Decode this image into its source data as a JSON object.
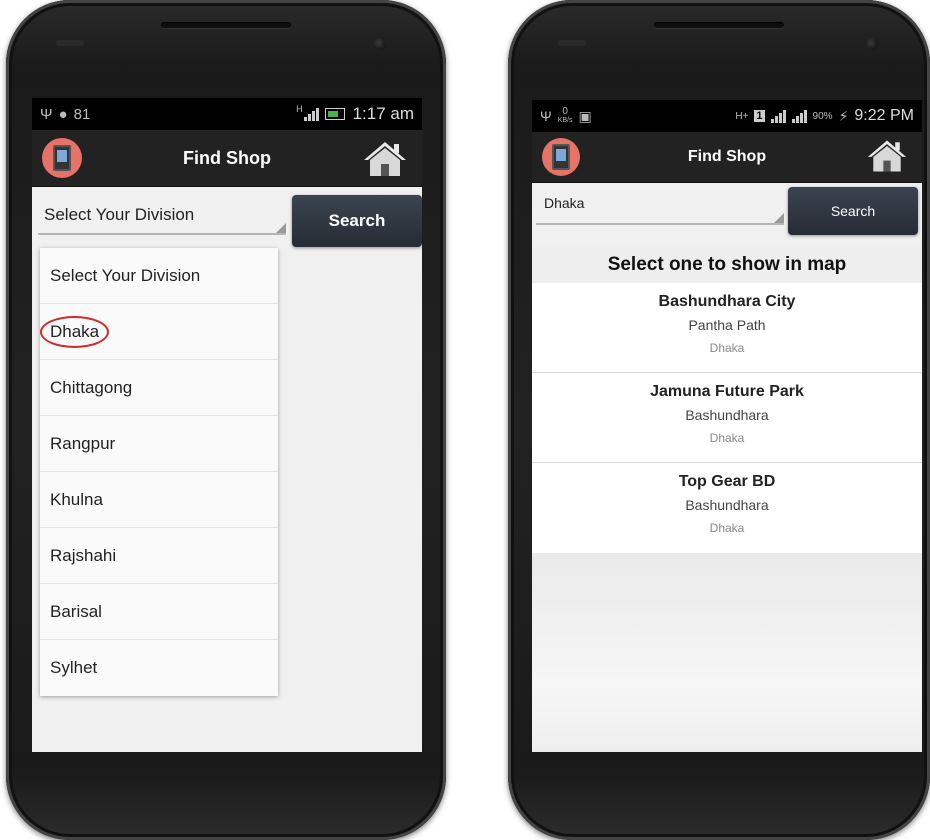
{
  "left_screen": {
    "status": {
      "battery_level": "81",
      "time": "1:17 am",
      "network": "H"
    },
    "appbar": {
      "title": "Find Shop"
    },
    "division_select": {
      "value": "Select Your Division"
    },
    "search_label": "Search",
    "options": [
      "Select Your Division",
      "Dhaka",
      "Chittagong",
      "Rangpur",
      "Khulna",
      "Rajshahi",
      "Barisal",
      "Sylhet"
    ],
    "highlighted_option": "Dhaka"
  },
  "right_screen": {
    "status": {
      "speed": "0",
      "speed_unit": "KB/s",
      "network": "H+",
      "sim": "1",
      "battery": "90%",
      "time": "9:22 PM"
    },
    "appbar": {
      "title": "Find Shop"
    },
    "division_select": {
      "value": "Dhaka"
    },
    "search_label": "Search",
    "list_title": "Select one to show in map",
    "shops": [
      {
        "name": "Bashundhara City",
        "address": "Pantha Path",
        "city": "Dhaka"
      },
      {
        "name": "Jamuna Future Park",
        "address": "Bashundhara",
        "city": "Dhaka"
      },
      {
        "name": "Top Gear BD",
        "address": "Bashundhara",
        "city": "Dhaka"
      }
    ]
  },
  "colors": {
    "appbar_bg": "#222222",
    "app_icon_bg": "#e57368",
    "search_btn_bg": "#2f3640",
    "highlight_circle": "#d02a2a"
  }
}
